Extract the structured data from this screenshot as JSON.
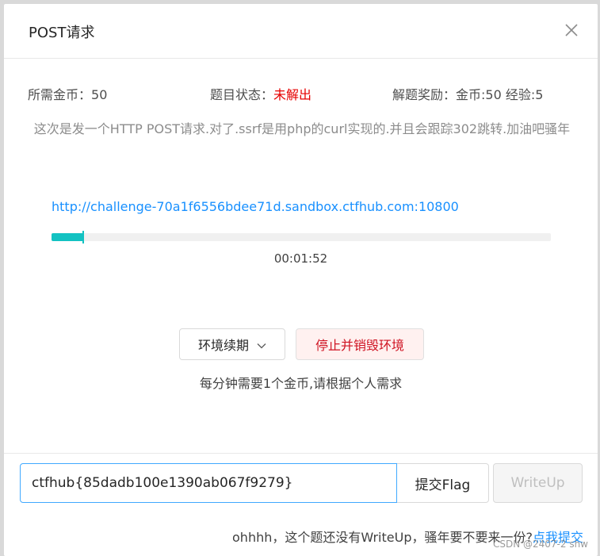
{
  "modal": {
    "title": "POST请求"
  },
  "info": {
    "coins_label": "所需金币：",
    "coins_value": "50",
    "status_label": "题目状态：",
    "status_value": "未解出",
    "reward_label": "解题奖励：",
    "reward_value": "金币:50 经验:5"
  },
  "description": "这次是发一个HTTP POST请求.对了.ssrf是用php的curl实现的.并且会跟踪302跳转.加油吧骚年",
  "environment": {
    "url": "http://challenge-70a1f6556bdee71d.sandbox.ctfhub.com:10800",
    "timer": "00:01:52",
    "renew_label": "环境续期",
    "destroy_label": "停止并销毁环境",
    "hint": "每分钟需要1个金币,请根据个人需求"
  },
  "footer": {
    "flag_value": "ctfhub{85dadb100e1390ab067f9279}",
    "submit_label": "提交Flag",
    "writeup_label": "WriteUp",
    "note_text": "ohhhh，这个题还没有WriteUp，骚年要不要来一份?",
    "note_link": "点我提交"
  },
  "watermark": "CSDN @2407-2 shw",
  "icons": {
    "close": "close-icon",
    "chevron": "chevron-down-icon"
  },
  "colors": {
    "accent": "#1890ff",
    "progress": "#13c2c2",
    "danger": "#e60000"
  }
}
